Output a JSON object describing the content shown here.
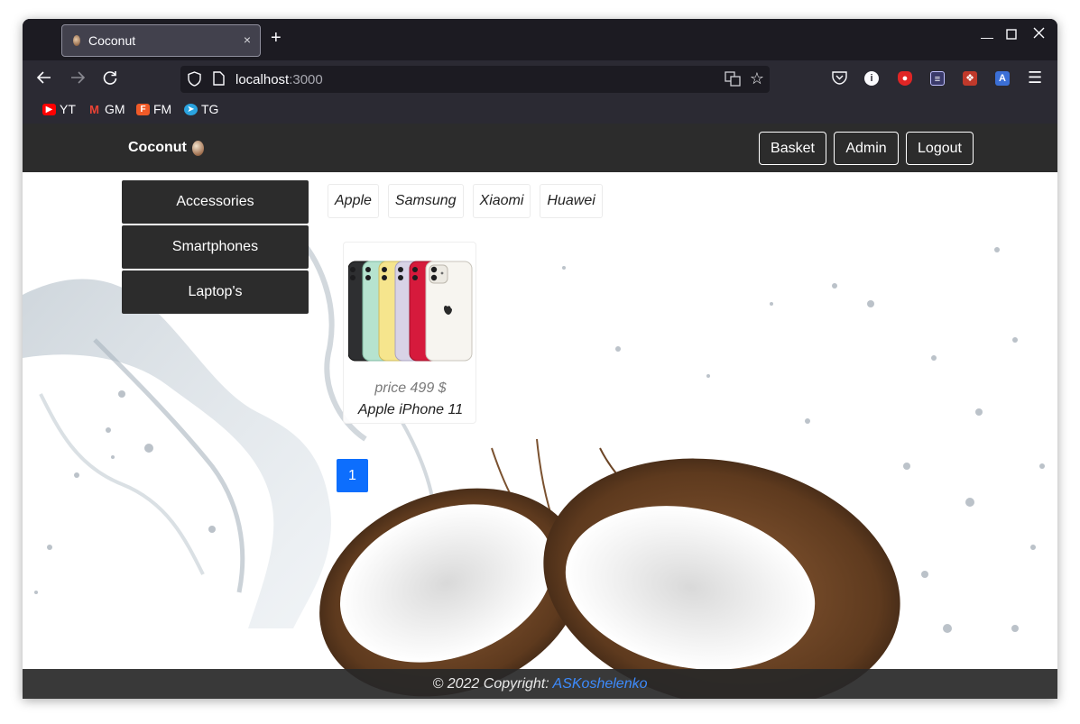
{
  "browser": {
    "tab_title": "Coconut",
    "tab_close": "×",
    "new_tab": "+",
    "url_host": "localhost",
    "url_port": ":3000",
    "bookmarks": [
      {
        "label": "YT",
        "icon": "youtube-icon",
        "color": "#ff0000"
      },
      {
        "label": "GM",
        "icon": "gmail-icon",
        "color": "#ea4335"
      },
      {
        "label": "FM",
        "icon": "fm-icon",
        "color": "#f05a28"
      },
      {
        "label": "TG",
        "icon": "telegram-icon",
        "color": "#2aa3df"
      }
    ]
  },
  "site": {
    "brand": "Coconut",
    "nav": {
      "basket": "Basket",
      "admin": "Admin",
      "logout": "Logout"
    },
    "categories": [
      "Accessories",
      "Smartphones",
      "Laptop's"
    ],
    "brands": [
      "Apple",
      "Samsung",
      "Xiaomi",
      "Huawei"
    ],
    "products": [
      {
        "price": "price 499 $",
        "name": "Apple iPhone 11"
      }
    ],
    "pagination": {
      "current": "1"
    },
    "footer": {
      "text": "© 2022 Copyright: ",
      "author": "ASKoshelenko"
    }
  },
  "colors": {
    "navbar_bg": "#2c2c2c",
    "accent": "#0d6efd",
    "link": "#3d8bfd"
  }
}
